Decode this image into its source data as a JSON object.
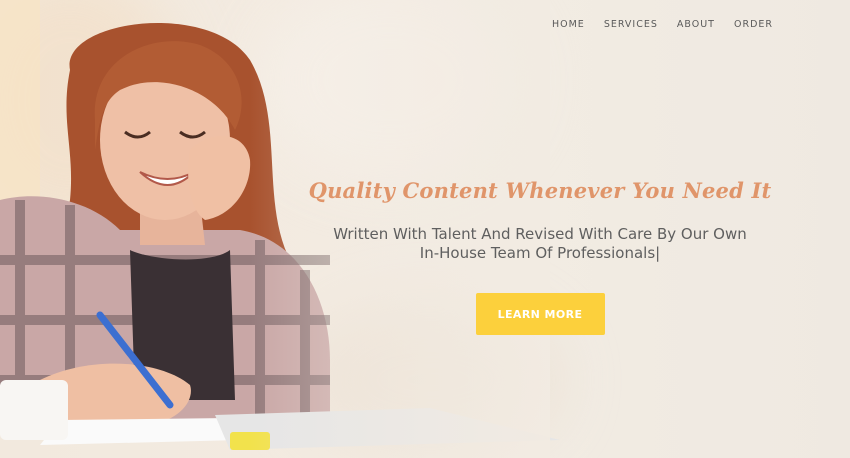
{
  "nav": {
    "items": [
      {
        "label": "HOME"
      },
      {
        "label": "SERVICES"
      },
      {
        "label": "ABOUT"
      },
      {
        "label": "ORDER"
      }
    ]
  },
  "hero": {
    "headline": "Quality Content Whenever You Need It",
    "subline_1": "Written With Talent And Revised With Care By Our Own",
    "subline_2": "In-House Team Of Professionals|",
    "cta_label": "LEARN MORE"
  },
  "colors": {
    "accent_headline": "#e0956a",
    "cta_background": "#fcd03c",
    "background": "#f2ebe2",
    "text": "#5f5f5f"
  }
}
